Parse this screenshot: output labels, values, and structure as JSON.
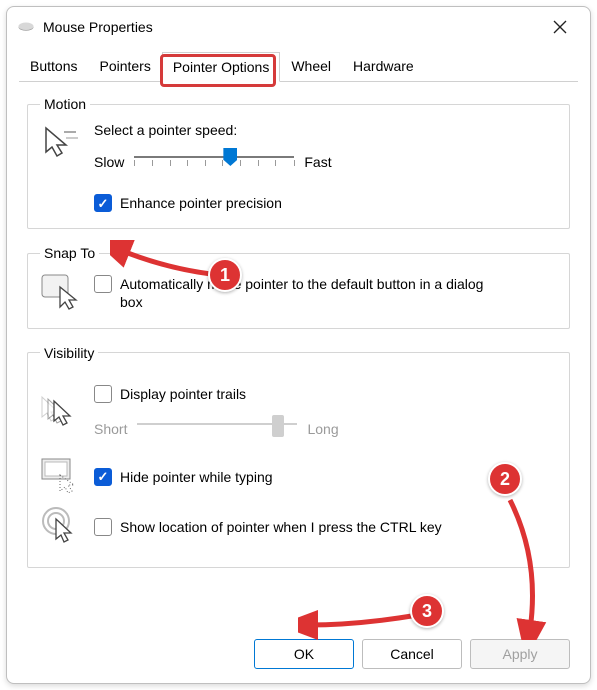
{
  "window": {
    "title": "Mouse Properties"
  },
  "tabs": {
    "items": [
      "Buttons",
      "Pointers",
      "Pointer Options",
      "Wheel",
      "Hardware"
    ],
    "active_index": 2
  },
  "motion": {
    "legend": "Motion",
    "speed_label": "Select a pointer speed:",
    "slow": "Slow",
    "fast": "Fast",
    "slider_value": 6,
    "slider_max": 10,
    "enhance_label": "Enhance pointer precision",
    "enhance_checked": true
  },
  "snap": {
    "legend": "Snap To",
    "auto_label": "Automatically move pointer to the default button in a dialog box",
    "auto_checked": false
  },
  "visibility": {
    "legend": "Visibility",
    "trails_label": "Display pointer trails",
    "trails_checked": false,
    "short": "Short",
    "long": "Long",
    "trails_value": 9,
    "trails_max": 10,
    "hide_label": "Hide pointer while typing",
    "hide_checked": true,
    "ctrl_label": "Show location of pointer when I press the CTRL key",
    "ctrl_checked": false
  },
  "buttons": {
    "ok": "OK",
    "cancel": "Cancel",
    "apply": "Apply"
  },
  "annotations": {
    "b1": "1",
    "b2": "2",
    "b3": "3"
  },
  "colors": {
    "accent": "#0078d4",
    "checked": "#0b5cd7",
    "anno": "#d33"
  }
}
